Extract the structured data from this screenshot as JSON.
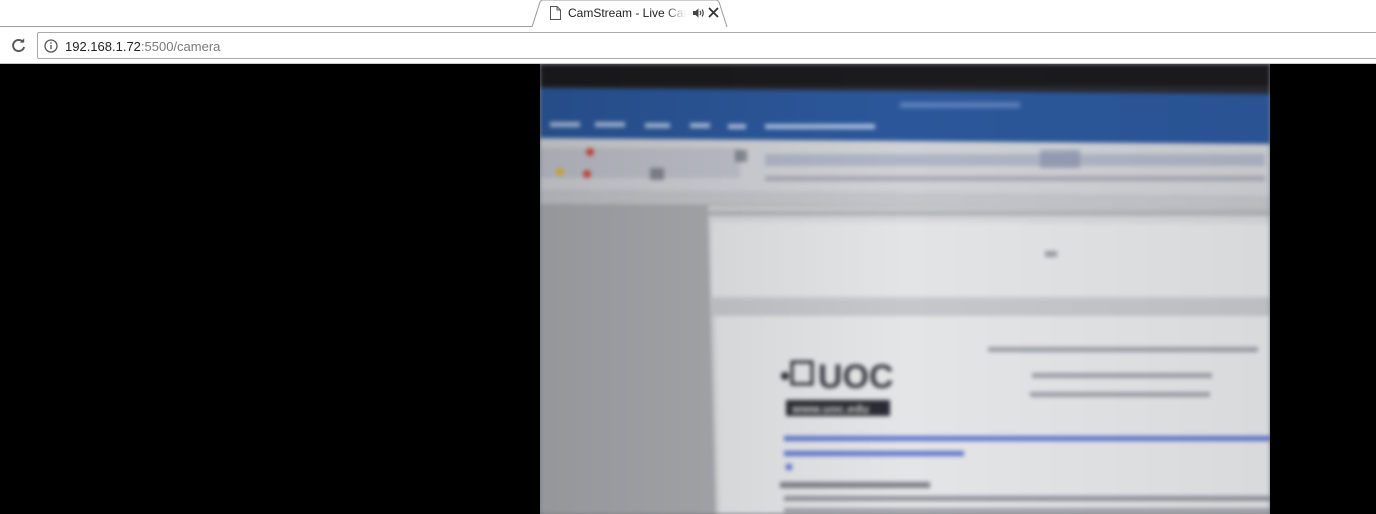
{
  "browser": {
    "tab": {
      "title": "CamStream - Live Camera",
      "page_icon": "document-icon",
      "audio_icon": "speaker-icon",
      "close_icon": "close-icon"
    },
    "toolbar": {
      "reload_icon": "reload-icon",
      "info_icon": "info-icon",
      "url_host": "192.168.1.72",
      "url_rest": ":5500/camera"
    }
  },
  "video": {
    "description_icon": "camera-feed",
    "word_doc": {
      "logo_text": "UOC",
      "logo_subtext": "www.uoc.edu"
    }
  },
  "colors": {
    "word_ribbon_blue": "#2b579a",
    "link_blue": "#3a56c8",
    "background": "#000000"
  }
}
